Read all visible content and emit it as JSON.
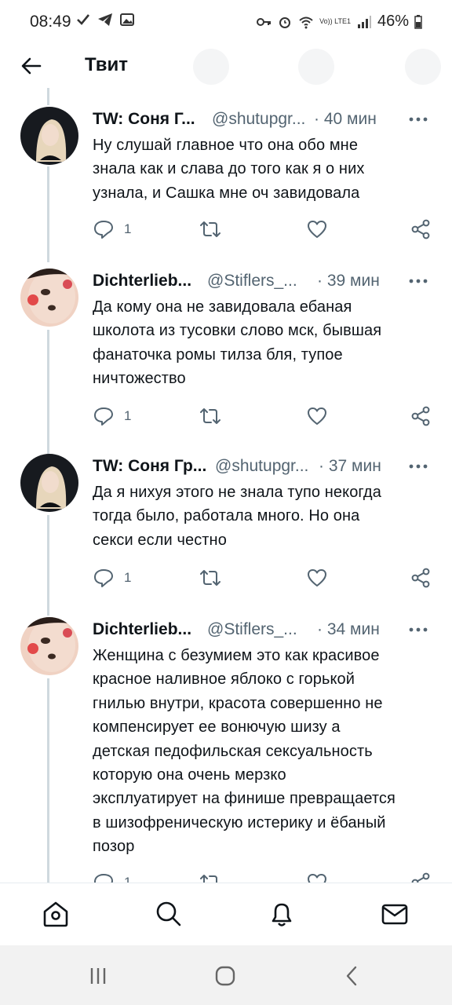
{
  "status_bar": {
    "time": "08:49",
    "network_label": "Vo)) LTE1",
    "battery": "46%"
  },
  "header": {
    "title": "Твит"
  },
  "tweets": [
    {
      "name": "TW: Соня Г...",
      "handle": "@shutupgr...",
      "time": "· 40 мин",
      "text_lines": [
        "Ну слушай главное что она обо мне",
        "знала как и слава до того как я о них",
        "узнала, и Сашка мне оч завидовала"
      ],
      "reply_count": "1",
      "avatar": "blonde-girl"
    },
    {
      "name": "Dichterlieb...",
      "handle": "@Stiflers_...",
      "time": "· 39 мин",
      "text_lines": [
        "Да кому она не завидовала ебаная",
        "школота из тусовки слово мск, бывшая",
        "фанаточка ромы тилза бля, тупое",
        "ничтожество"
      ],
      "reply_count": "1",
      "avatar": "face-closeup"
    },
    {
      "name": "TW: Соня Гр...",
      "handle": "@shutupgr...",
      "time": "· 37 мин",
      "text_lines": [
        "Да я нихуя этого не знала тупо некогда",
        "тогда было, работала много. Но она",
        "секси если честно"
      ],
      "reply_count": "1",
      "avatar": "blonde-girl"
    },
    {
      "name": "Dichterlieb...",
      "handle": "@Stiflers_...",
      "time": "· 34 мин",
      "text_lines": [
        "Женщина с безумием это как красивое",
        "красное наливное яблоко с горькой",
        "гнилью внутри, красота совершенно не",
        "компенсирует ее вонючую шизу а",
        "детская педофильская сексуальность",
        "которую она очень мерзко",
        "эксплуатирует на финише превращается",
        "в шизофреническую истерику и ёбаный",
        "позор"
      ],
      "reply_count": "1",
      "avatar": "face-closeup"
    }
  ],
  "icons": {
    "reply": "reply-icon",
    "retweet": "retweet-icon",
    "like": "like-icon",
    "share": "share-icon",
    "more": "more-icon"
  },
  "bottom_nav": [
    "home-icon",
    "search-icon",
    "notifications-icon",
    "messages-icon"
  ],
  "colors": {
    "text": "#0f1419",
    "secondary": "#536471",
    "thread_line": "#cfd9de"
  }
}
